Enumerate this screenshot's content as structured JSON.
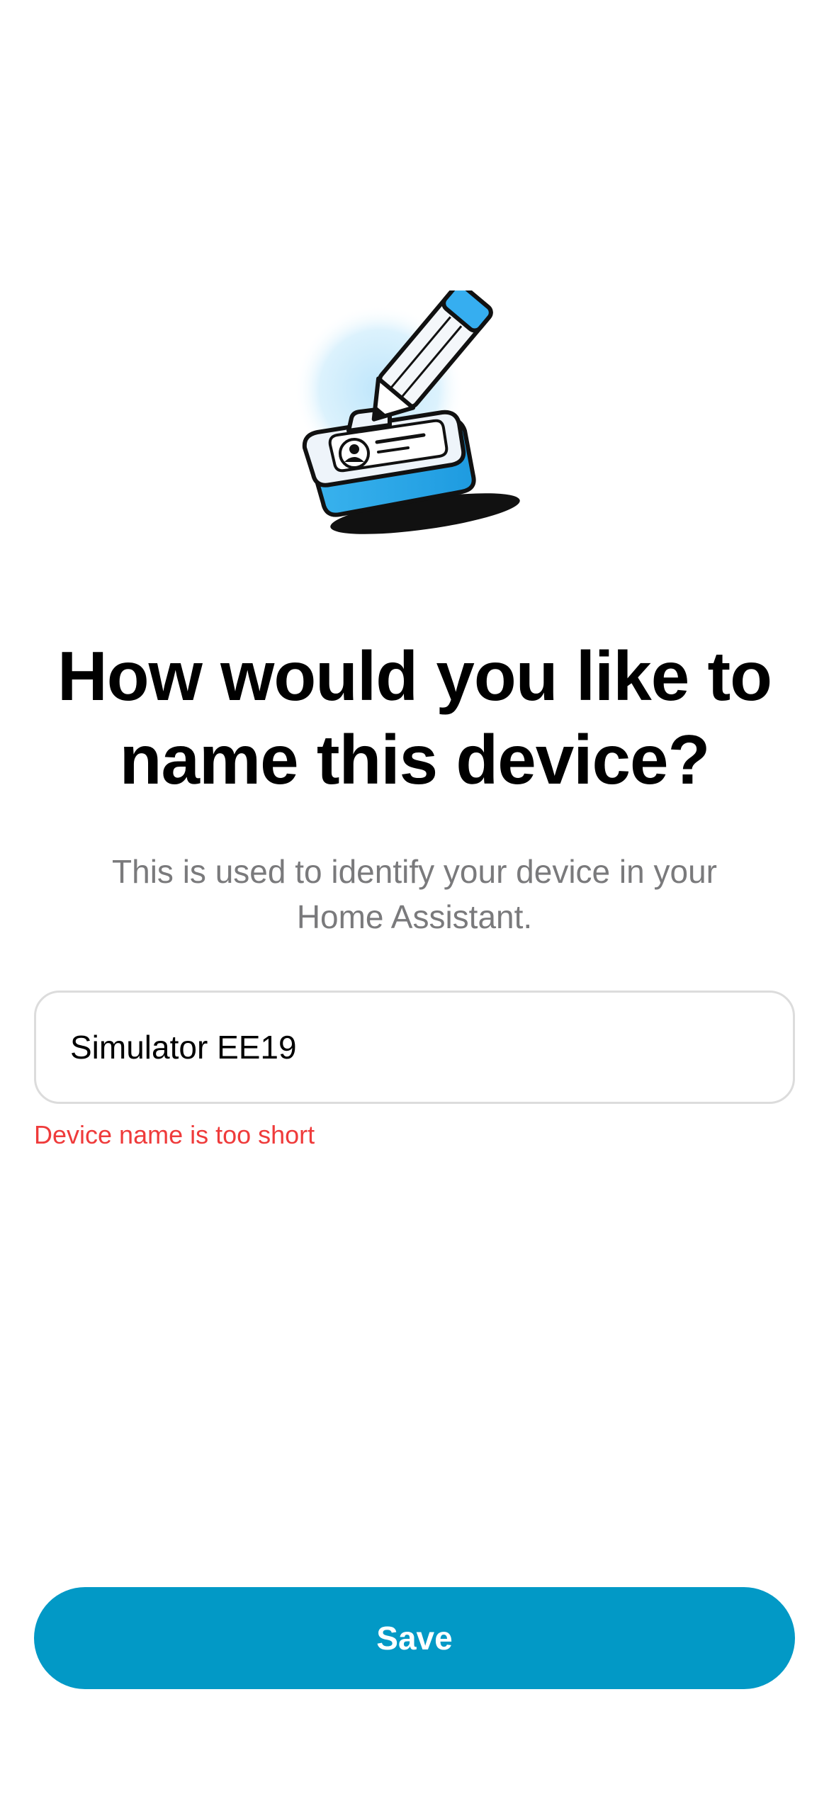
{
  "illustration": {
    "icon": "device-id-card-pencil-icon"
  },
  "title": "How would you like to name this device?",
  "subtitle": "This is used to identify your device in your Home Assistant.",
  "device_name_field": {
    "value": "Simulator EE19",
    "placeholder": ""
  },
  "error_message": "Device name is too short",
  "save_button": {
    "label": "Save"
  },
  "colors": {
    "accent": "#0299c6",
    "error": "#ef3b3b",
    "subtitle_text": "#7a7a7c",
    "field_border": "#dcdcdc"
  }
}
